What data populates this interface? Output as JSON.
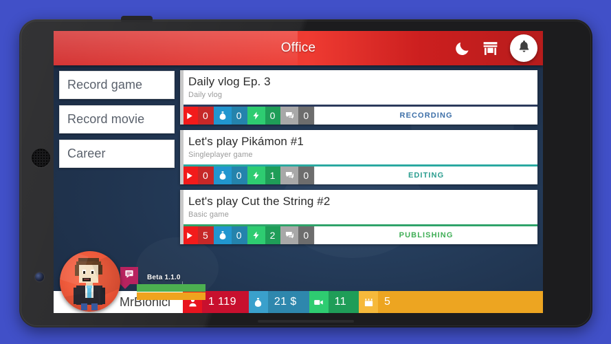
{
  "app": {
    "title": "Office",
    "actions": [
      {
        "name": "moon-icon",
        "label": "Sleep"
      },
      {
        "name": "store-icon",
        "label": "Shop"
      },
      {
        "name": "bell-icon",
        "label": "Notifications"
      }
    ]
  },
  "menu": {
    "items": [
      {
        "label": "Record game"
      },
      {
        "label": "Record movie"
      },
      {
        "label": "Career"
      }
    ]
  },
  "tasks": [
    {
      "title": "Daily vlog Ep. 3",
      "subtitle": "Daily vlog",
      "accent": "#c9c9c9",
      "topline": "#2b3a5c",
      "status": "RECORDING",
      "status_color": "#3d6fa8",
      "stats": [
        {
          "icon": "play-icon",
          "value": "0",
          "kind": "views"
        },
        {
          "icon": "money-bag-icon",
          "value": "0",
          "kind": "money"
        },
        {
          "icon": "bolt-icon",
          "value": "0",
          "kind": "energy"
        },
        {
          "icon": "comment-icon",
          "value": "0",
          "kind": "comments"
        }
      ]
    },
    {
      "title": "Let's play Pikámon #1",
      "subtitle": "Singleplayer game",
      "accent": "#c9c9c9",
      "topline": "#2aa9a0",
      "status": "EDITING",
      "status_color": "#2a9d8f",
      "stats": [
        {
          "icon": "play-icon",
          "value": "0",
          "kind": "views"
        },
        {
          "icon": "money-bag-icon",
          "value": "0",
          "kind": "money"
        },
        {
          "icon": "bolt-icon",
          "value": "1",
          "kind": "energy"
        },
        {
          "icon": "comment-icon",
          "value": "0",
          "kind": "comments"
        }
      ]
    },
    {
      "title": "Let's play Cut the String #2",
      "subtitle": "Basic game",
      "accent": "#c9c9c9",
      "topline": "#2fa36a",
      "status": "PUBLISHING",
      "status_color": "#3fae56",
      "stats": [
        {
          "icon": "play-icon",
          "value": "5",
          "kind": "views"
        },
        {
          "icon": "money-bag-icon",
          "value": "0",
          "kind": "money"
        },
        {
          "icon": "bolt-icon",
          "value": "2",
          "kind": "energy"
        },
        {
          "icon": "comment-icon",
          "value": "0",
          "kind": "comments"
        }
      ]
    }
  ],
  "hud": {
    "username": "MrBionicl",
    "version": "Beta 1.1.0",
    "resources": [
      {
        "icon": "subscriber-icon",
        "value": "1 119",
        "kind": "subs",
        "color": "#c8102e"
      },
      {
        "icon": "money-bag-icon",
        "value": "21 $",
        "kind": "money",
        "color": "#2e87ad"
      },
      {
        "icon": "video-camera-icon",
        "value": "11",
        "kind": "videos",
        "color": "#1f9d58"
      },
      {
        "icon": "calendar-icon",
        "value": "5",
        "kind": "days",
        "color": "#eda521"
      }
    ]
  }
}
